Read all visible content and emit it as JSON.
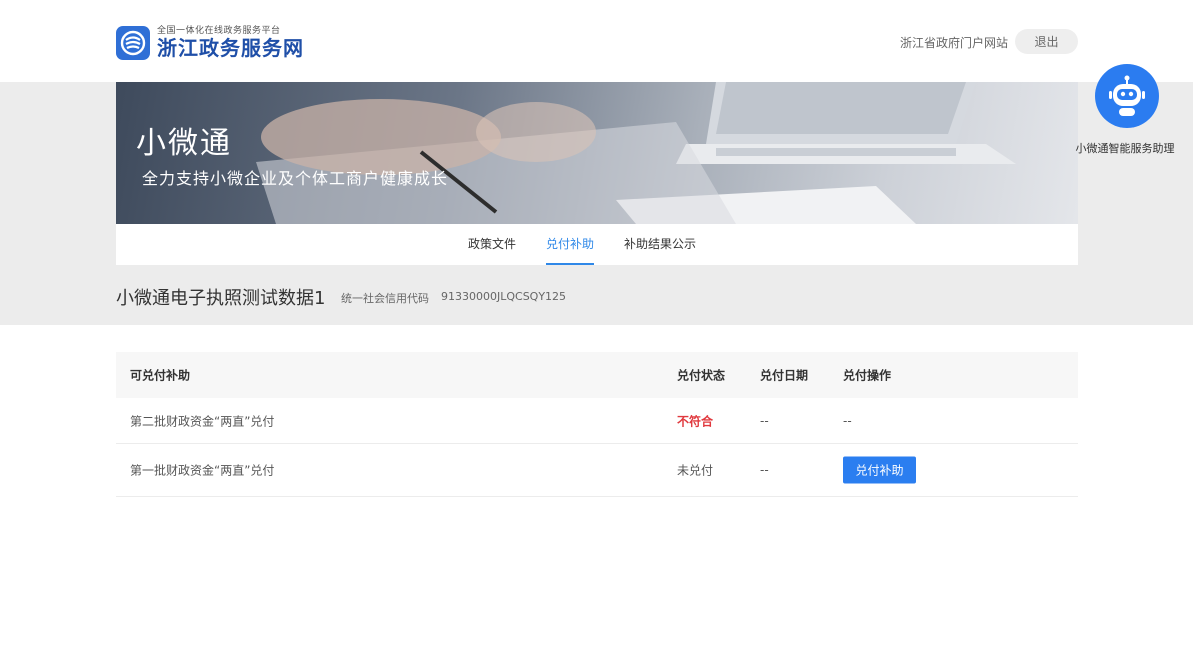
{
  "header": {
    "logo_subtitle": "全国一体化在线政务服务平台",
    "logo_title": "浙江政务服务网",
    "portal_link": "浙江省政府门户网站",
    "logout": "退出"
  },
  "banner": {
    "title": "小微通",
    "slogan": "全力支持小微企业及个体工商户健康成长"
  },
  "tabs": [
    {
      "label": "政策文件",
      "active": false
    },
    {
      "label": "兑付补助",
      "active": true
    },
    {
      "label": "补助结果公示",
      "active": false
    }
  ],
  "company": {
    "name": "小微通电子执照测试数据1",
    "credit_label": "统一社会信用代码",
    "credit_code": "91330000JLQCSQY125"
  },
  "assistant": {
    "label": "小微通智能服务助理"
  },
  "table": {
    "headers": [
      "可兑付补助",
      "兑付状态",
      "兑付日期",
      "兑付操作"
    ],
    "rows": [
      {
        "name": "第二批财政资金“两直”兑付",
        "status": "不符合",
        "date": "--",
        "action": "--"
      },
      {
        "name": "第一批财政资金“两直”兑付",
        "status": "未兑付",
        "date": "--",
        "action_button": "兑付补助"
      }
    ]
  },
  "colors": {
    "accent": "#2f88e8",
    "button": "#2b7ef0",
    "status_fail": "#e0393e",
    "logo": "#1f4fa8"
  }
}
